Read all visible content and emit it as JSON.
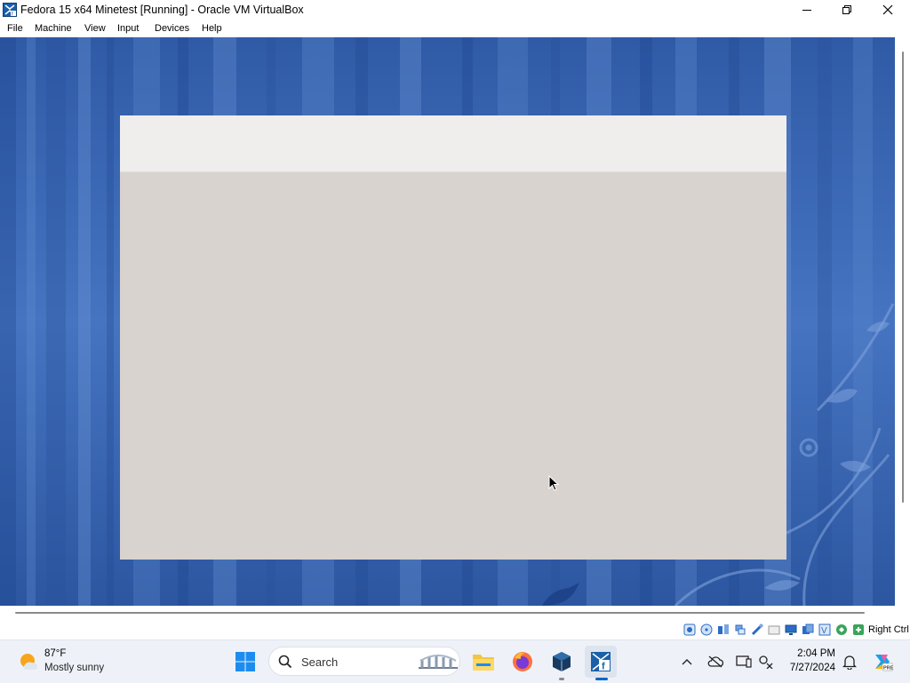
{
  "window": {
    "title": "Fedora 15 x64 Minetest [Running] - Oracle VM VirtualBox"
  },
  "menu": {
    "items": [
      "File",
      "Machine",
      "View",
      "Input",
      "Devices",
      "Help"
    ]
  },
  "statusbar": {
    "host_key": "Right Ctrl",
    "icons": [
      "hard-disk-icon",
      "optical-drive-icon",
      "audio-icon",
      "network-icon",
      "usb-icon",
      "shared-folders-icon",
      "display-icon",
      "recording-icon",
      "virtualization-icon",
      "mouse-integration-icon",
      "keyboard-icon"
    ]
  },
  "taskbar": {
    "weather": {
      "temp": "87°F",
      "desc": "Mostly sunny"
    },
    "search": {
      "placeholder": "Search"
    },
    "apps": [
      "start-icon",
      "file-explorer-icon",
      "firefox-icon",
      "virtualbox-icon",
      "fedora-vm-icon"
    ],
    "clock": {
      "time": "2:04 PM",
      "date": "7/27/2024"
    }
  },
  "colors": {
    "accent": "#0067c0",
    "desktop_blue": "#3b67b3",
    "guest_window_body": "#d8d3cf",
    "guest_window_header": "#efeeec"
  }
}
